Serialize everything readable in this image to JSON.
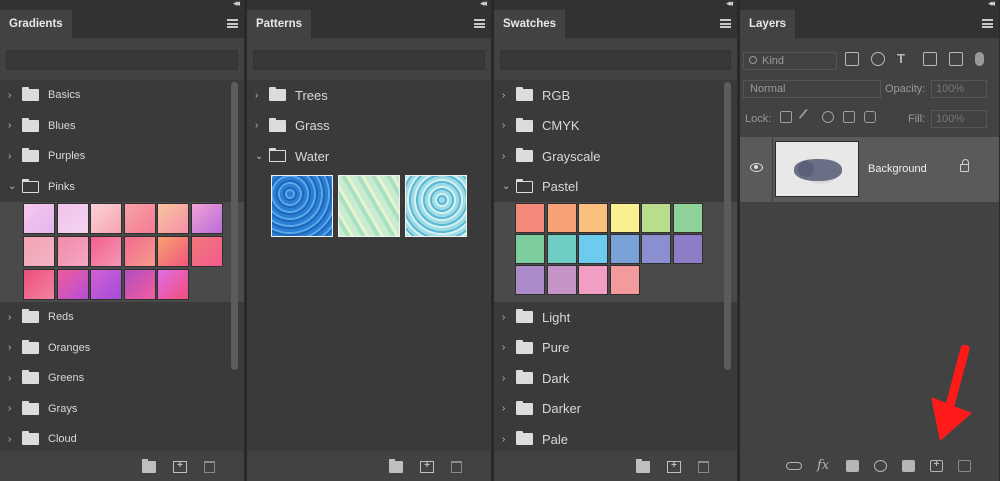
{
  "panels": {
    "gradients": {
      "title": "Gradients",
      "items": [
        {
          "label": "Basics",
          "open": false
        },
        {
          "label": "Blues",
          "open": false
        },
        {
          "label": "Purples",
          "open": false
        },
        {
          "label": "Pinks",
          "open": true
        },
        {
          "label": "Reds",
          "open": false
        },
        {
          "label": "Oranges",
          "open": false
        },
        {
          "label": "Greens",
          "open": false
        },
        {
          "label": "Grays",
          "open": false
        },
        {
          "label": "Cloud",
          "open": false
        }
      ],
      "pink_swatches": [
        [
          "#f7c8ef",
          "#e4b6ee"
        ],
        [
          "#f0c4ea",
          "#f5d4f1"
        ],
        [
          "#fbd0d6",
          "#f7a6b2"
        ],
        [
          "#f8a2a8",
          "#f47b92"
        ],
        [
          "#f9c59e",
          "#f490a8"
        ],
        [
          "#f0a3d5",
          "#b86bd9"
        ],
        [
          "#f4a3b5",
          "#f1b4c4"
        ],
        [
          "#f18aa8",
          "#f4a8c5"
        ],
        [
          "#f45f8c",
          "#f497b6"
        ],
        [
          "#f06a8f",
          "#f79c8d"
        ],
        [
          "#f5a26e",
          "#f4567e"
        ],
        [
          "#f27a7a",
          "#f35a8f"
        ],
        [
          "#ec4d7c",
          "#f484a2"
        ],
        [
          "#f05b9a",
          "#b44fd6"
        ],
        [
          "#d460d7",
          "#a34cd8"
        ],
        [
          "#b04ec0",
          "#f45d9e"
        ],
        [
          "#e06ee7",
          "#f24d7a"
        ]
      ]
    },
    "patterns": {
      "title": "Patterns",
      "items": [
        {
          "label": "Trees",
          "open": false
        },
        {
          "label": "Grass",
          "open": false
        },
        {
          "label": "Water",
          "open": true
        }
      ]
    },
    "swatches": {
      "title": "Swatches",
      "items_before": [
        {
          "label": "RGB",
          "open": false
        },
        {
          "label": "CMYK",
          "open": false
        },
        {
          "label": "Grayscale",
          "open": false
        },
        {
          "label": "Pastel",
          "open": true
        }
      ],
      "pastel_colors": [
        "#f4897a",
        "#f7a176",
        "#fbc07d",
        "#fbf08f",
        "#b9dd8b",
        "#90d198",
        "#7ccd9d",
        "#6fcdc3",
        "#6ccbef",
        "#7aa1d8",
        "#8c8fcf",
        "#8f7cc6",
        "#aa8ac7",
        "#c693c7",
        "#f29dc3",
        "#f39a9c"
      ],
      "items_after": [
        {
          "label": "Light",
          "open": false
        },
        {
          "label": "Pure",
          "open": false
        },
        {
          "label": "Dark",
          "open": false
        },
        {
          "label": "Darker",
          "open": false
        },
        {
          "label": "Pale",
          "open": false
        }
      ]
    },
    "layers": {
      "title": "Layers",
      "kind_placeholder": "Kind",
      "blend_mode": "Normal",
      "opacity_label": "Opacity:",
      "opacity_value": "100%",
      "lock_label": "Lock:",
      "fill_label": "Fill:",
      "fill_value": "100%",
      "layer_name": "Background"
    }
  },
  "colors": {
    "panel_bg": "#424242",
    "list_bg": "#3a3a3a",
    "annotation_arrow": "#ff1a1a"
  }
}
